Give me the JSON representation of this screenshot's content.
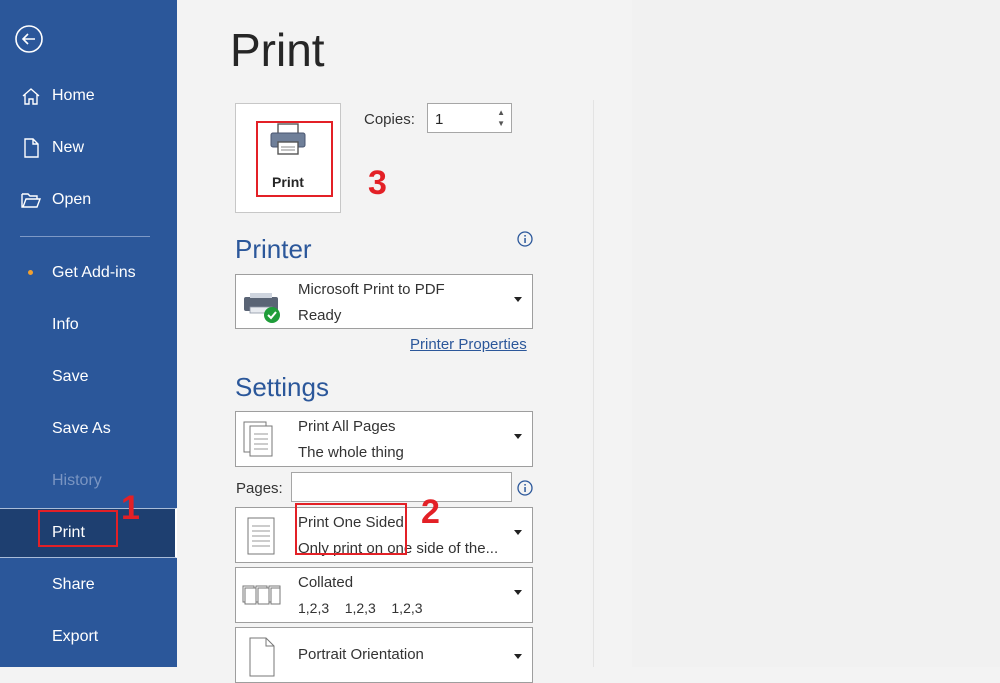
{
  "sidebar": {
    "back_icon": "back-arrow-icon",
    "items": [
      {
        "label": "Home",
        "icon": "home-icon"
      },
      {
        "label": "New",
        "icon": "new-doc-icon"
      },
      {
        "label": "Open",
        "icon": "folder-open-icon"
      },
      {
        "label": "Get Add-ins"
      },
      {
        "label": "Info"
      },
      {
        "label": "Save"
      },
      {
        "label": "Save As"
      },
      {
        "label": "History",
        "disabled": true
      },
      {
        "label": "Print",
        "selected": true
      },
      {
        "label": "Share"
      },
      {
        "label": "Export"
      }
    ]
  },
  "main": {
    "title": "Print",
    "print_button_label": "Print",
    "copies_label": "Copies:",
    "copies_value": "1",
    "printer_heading": "Printer",
    "printer": {
      "name": "Microsoft Print to PDF",
      "status": "Ready"
    },
    "printer_properties_link": "Printer Properties",
    "settings_heading": "Settings",
    "settings": [
      {
        "line1": "Print All Pages",
        "line2": "The whole thing"
      },
      {
        "line1": "Print One Sided",
        "line2": "Only print on one side of the..."
      },
      {
        "line1": "Collated",
        "line2": "1,2,3    1,2,3    1,2,3"
      },
      {
        "line1": "Portrait Orientation",
        "line2": ""
      }
    ],
    "pages_label": "Pages:",
    "pages_value": ""
  },
  "annotations": {
    "one": "1",
    "two": "2",
    "three": "3",
    "color": "#e32026"
  },
  "colors": {
    "sidebar": "#2b579a",
    "selected": "#1e3f70",
    "accent": "#2b579a"
  }
}
